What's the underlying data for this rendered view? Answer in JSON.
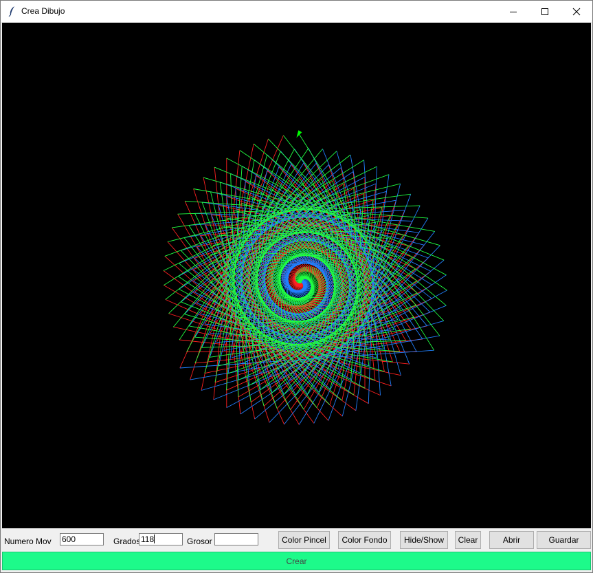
{
  "window": {
    "title": "Crea Dibujo",
    "controls": [
      "minimize",
      "maximize",
      "close"
    ]
  },
  "canvas": {
    "background": "#000000",
    "stroke_colors": [
      "#ff2020",
      "#2080ff",
      "#20ff40"
    ],
    "turtle_color": "#00ff00"
  },
  "toolbar": {
    "numero_label": "Numero Mov",
    "numero_value": "600",
    "grados_label": "Grados",
    "grados_value": "118",
    "grosor_label": "Grosor",
    "grosor_value": "",
    "color_pincel": "Color Pincel",
    "color_fondo": "Color Fondo",
    "hide_show": "Hide/Show",
    "clear": "Clear",
    "abrir": "Abrir",
    "guardar": "Guardar"
  },
  "create_button": {
    "label": "Crear",
    "color": "#1dfa8a"
  },
  "icons": {
    "app": "feather-icon",
    "minimize": "minimize-icon",
    "maximize": "maximize-icon",
    "close": "close-icon",
    "turtle": "turtle-arrow-icon"
  }
}
